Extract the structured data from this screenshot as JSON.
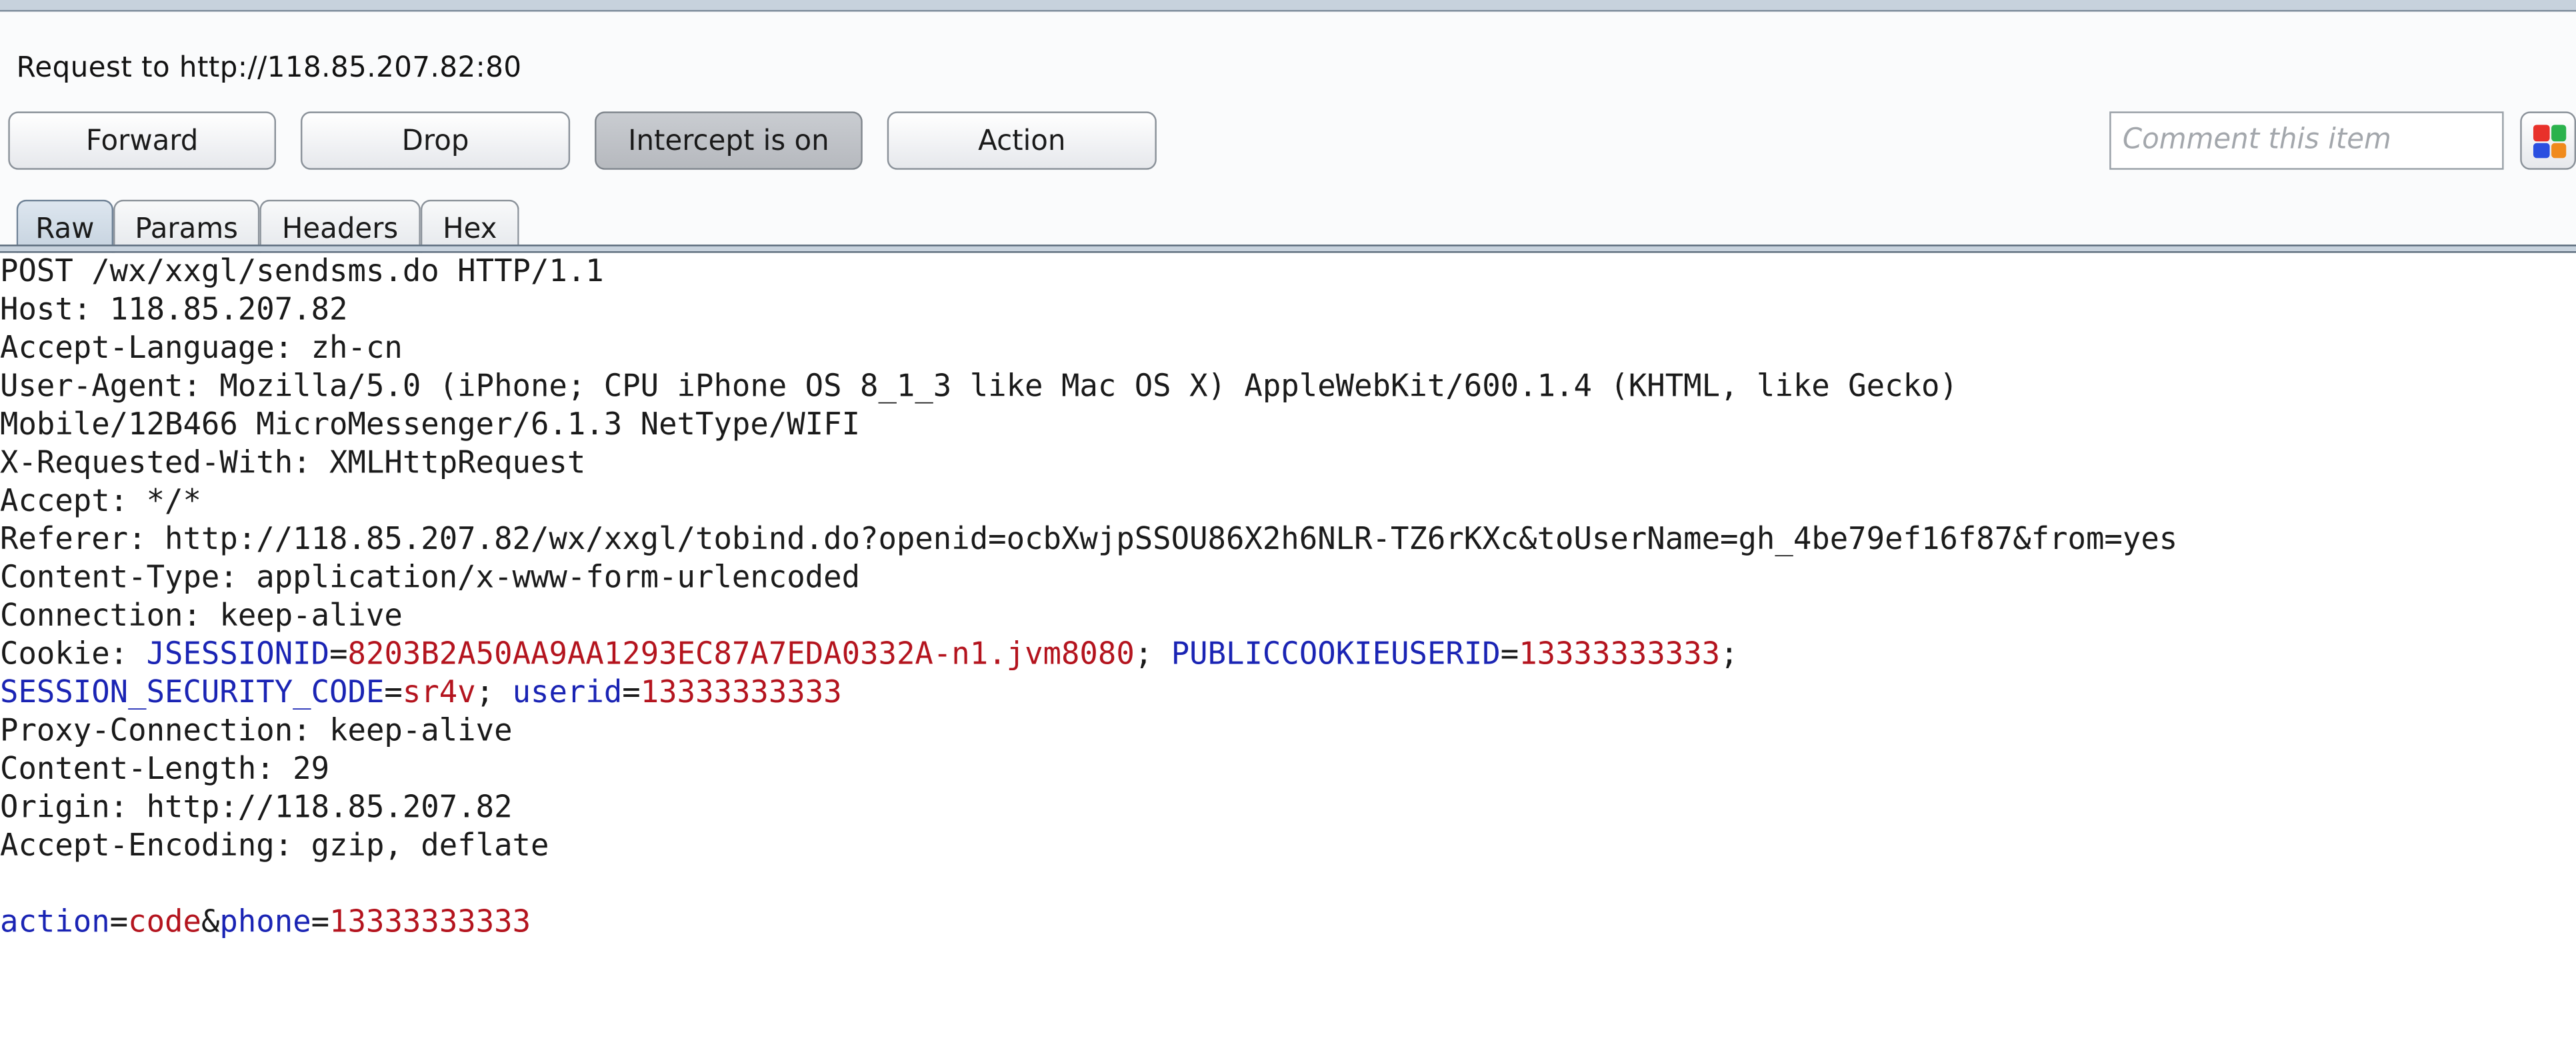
{
  "window": {
    "request_title": "Request to http://118.85.207.82:80"
  },
  "toolbar": {
    "forward_label": "Forward",
    "drop_label": "Drop",
    "intercept_label": "Intercept is on",
    "action_label": "Action",
    "comment_placeholder": "Comment this item",
    "color_icon": "color-highlight-icon"
  },
  "tabs": [
    {
      "label": "Raw",
      "active": true
    },
    {
      "label": "Params",
      "active": false
    },
    {
      "label": "Headers",
      "active": false
    },
    {
      "label": "Hex",
      "active": false
    }
  ],
  "request": {
    "request_line": "POST /wx/xxgl/sendsms.do HTTP/1.1",
    "host": "Host: 118.85.207.82",
    "accept_language": "Accept-Language: zh-cn",
    "user_agent_1": "User-Agent: Mozilla/5.0 (iPhone; CPU iPhone OS 8_1_3 like Mac OS X) AppleWebKit/600.1.4 (KHTML, like Gecko)",
    "user_agent_2": "Mobile/12B466 MicroMessenger/6.1.3 NetType/WIFI",
    "x_requested_with": "X-Requested-With: XMLHttpRequest",
    "accept": "Accept: */*",
    "referer": "Referer: http://118.85.207.82/wx/xxgl/tobind.do?openid=ocbXwjpSSOU86X2h6NLR-TZ6rKXc&toUserName=gh_4be79ef16f87&from=yes",
    "content_type": "Content-Type: application/x-www-form-urlencoded",
    "connection": "Connection: keep-alive",
    "cookie": {
      "prefix": "Cookie: ",
      "jsessionid_key": "JSESSIONID",
      "jsessionid_value": "8203B2A50AA9AA1293EC87A7EDA0332A-n1.jvm8080",
      "publiccookieuserid_key": "PUBLICCOOKIEUSERID",
      "publiccookieuserid_value": "13333333333",
      "session_security_code_key": "SESSION_SECURITY_CODE",
      "session_security_code_value": "sr4v",
      "userid_key": "userid",
      "userid_value": "13333333333"
    },
    "proxy_connection": "Proxy-Connection: keep-alive",
    "content_length": "Content-Length: 29",
    "origin": "Origin: http://118.85.207.82",
    "accept_encoding": "Accept-Encoding: gzip, deflate",
    "body": {
      "action_key": "action",
      "action_value": "code",
      "phone_key": "phone",
      "phone_value": "13333333333"
    }
  },
  "colors": {
    "param_name": "#1a24b4",
    "param_value": "#b4141e",
    "swatch": [
      "#e8312a",
      "#2bb24c",
      "#2a4fe0",
      "#f08a1c"
    ]
  }
}
